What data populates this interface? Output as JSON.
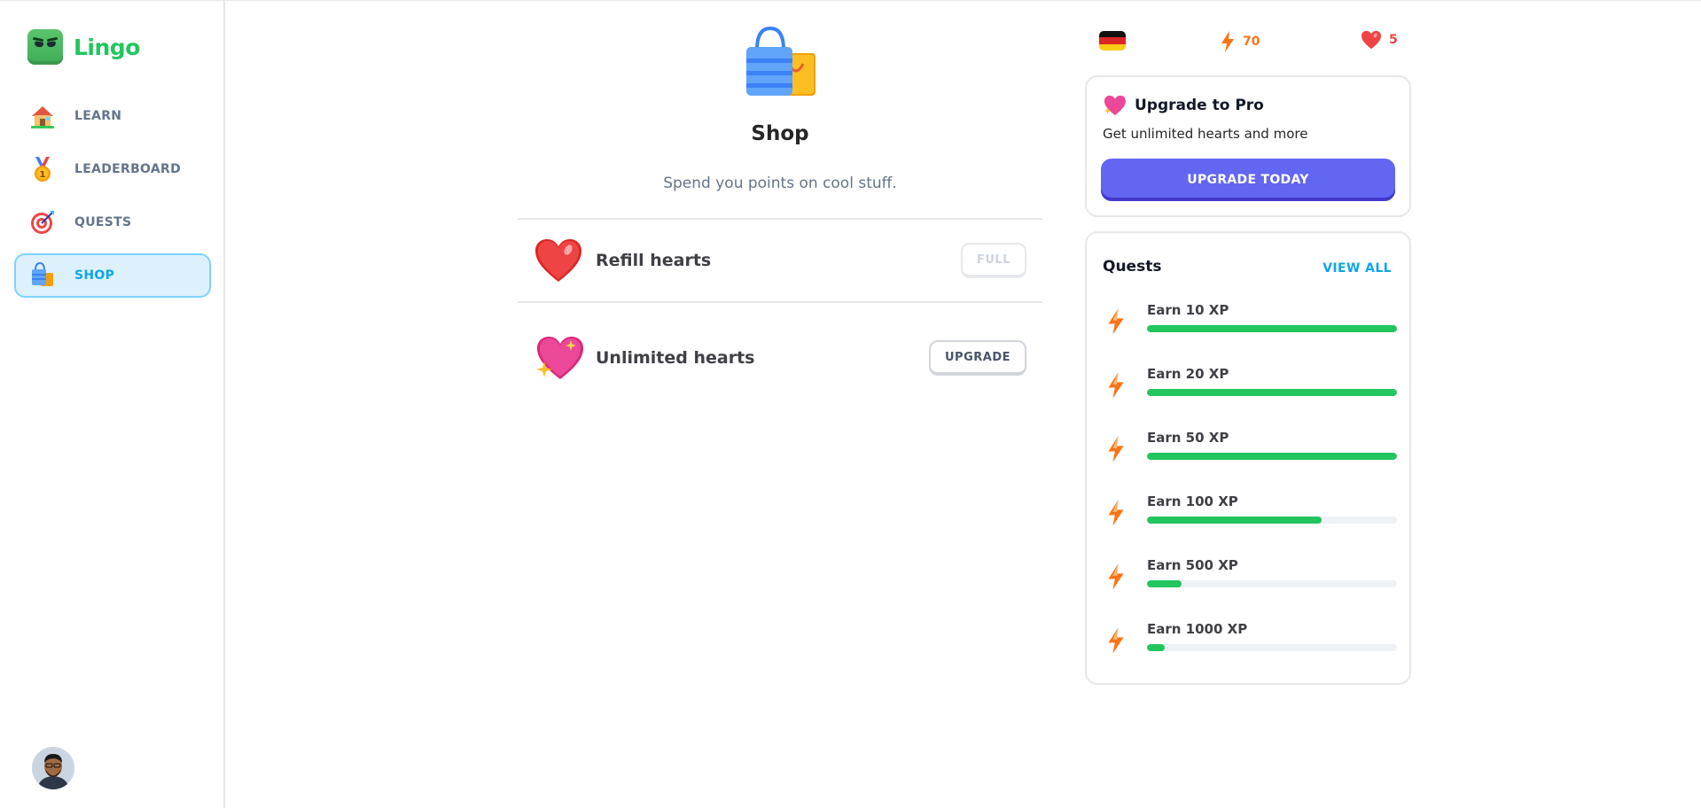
{
  "brand": {
    "name": "Lingo"
  },
  "sidebar": {
    "items": [
      {
        "label": "LEARN",
        "icon": "house-icon",
        "active": false
      },
      {
        "label": "LEADERBOARD",
        "icon": "medal-icon",
        "active": false
      },
      {
        "label": "QUESTS",
        "icon": "target-icon",
        "active": false
      },
      {
        "label": "SHOP",
        "icon": "shopping-bag-icon",
        "active": true
      }
    ]
  },
  "shop": {
    "title": "Shop",
    "subtitle": "Spend you points on cool stuff.",
    "items": [
      {
        "label": "Refill hearts",
        "button": "FULL"
      },
      {
        "label": "Unlimited hearts",
        "button": "UPGRADE"
      }
    ]
  },
  "stats": {
    "xp": "70",
    "hearts": "5",
    "course_flag": "germany-flag-icon"
  },
  "pro": {
    "title": "Upgrade to Pro",
    "description": "Get unlimited hearts and more",
    "button": "UPGRADE TODAY"
  },
  "quests": {
    "title": "Quests",
    "view_all": "VIEW ALL",
    "items": [
      {
        "label": "Earn 10 XP",
        "progress": 100
      },
      {
        "label": "Earn 20 XP",
        "progress": 100
      },
      {
        "label": "Earn 50 XP",
        "progress": 100
      },
      {
        "label": "Earn 100 XP",
        "progress": 70
      },
      {
        "label": "Earn 500 XP",
        "progress": 14
      },
      {
        "label": "Earn 1000 XP",
        "progress": 7
      }
    ]
  },
  "colors": {
    "brand": "#22c55e",
    "active_nav": "#0ea5e9",
    "upgrade_button": "#6366f1",
    "xp": "#f97316",
    "hearts": "#ef4444"
  }
}
